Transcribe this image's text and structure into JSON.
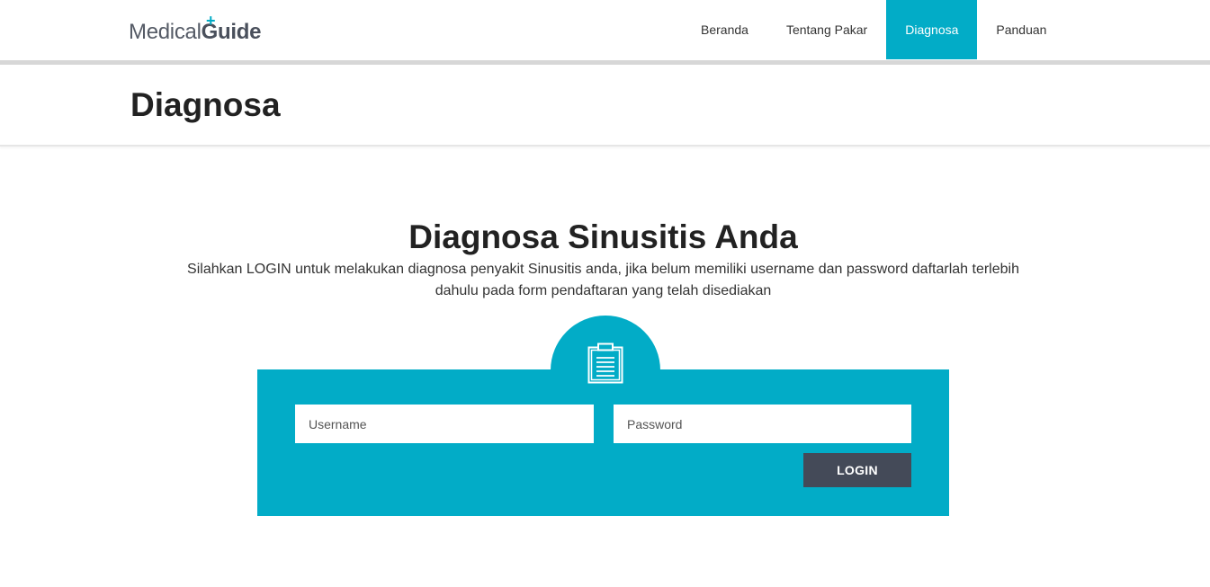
{
  "brand": {
    "part1": "Medical",
    "part2": "Guide",
    "plus": "+",
    "accent_color": "#02acc7"
  },
  "nav": {
    "items": [
      {
        "label": "Beranda"
      },
      {
        "label": "Tentang Pakar"
      },
      {
        "label": "Diagnosa",
        "active": true
      },
      {
        "label": "Panduan"
      }
    ]
  },
  "page": {
    "title": "Diagnosa"
  },
  "content": {
    "heading_light": "Diagnosa ",
    "heading_bold": "Sinusitis Anda",
    "subtext_line1": "Silahkan LOGIN untuk melakukan diagnosa penyakit Sinusitis anda, jika belum memiliki username dan password daftarlah terlebih",
    "subtext_line2": "dahulu pada form pendaftaran yang telah disediakan"
  },
  "login": {
    "icon": "clipboard-icon",
    "username": {
      "placeholder": "Username",
      "value": ""
    },
    "password": {
      "placeholder": "Password",
      "value": ""
    },
    "button_label": "LOGIN",
    "panel_color": "#02acc7",
    "button_color": "#444a58"
  }
}
